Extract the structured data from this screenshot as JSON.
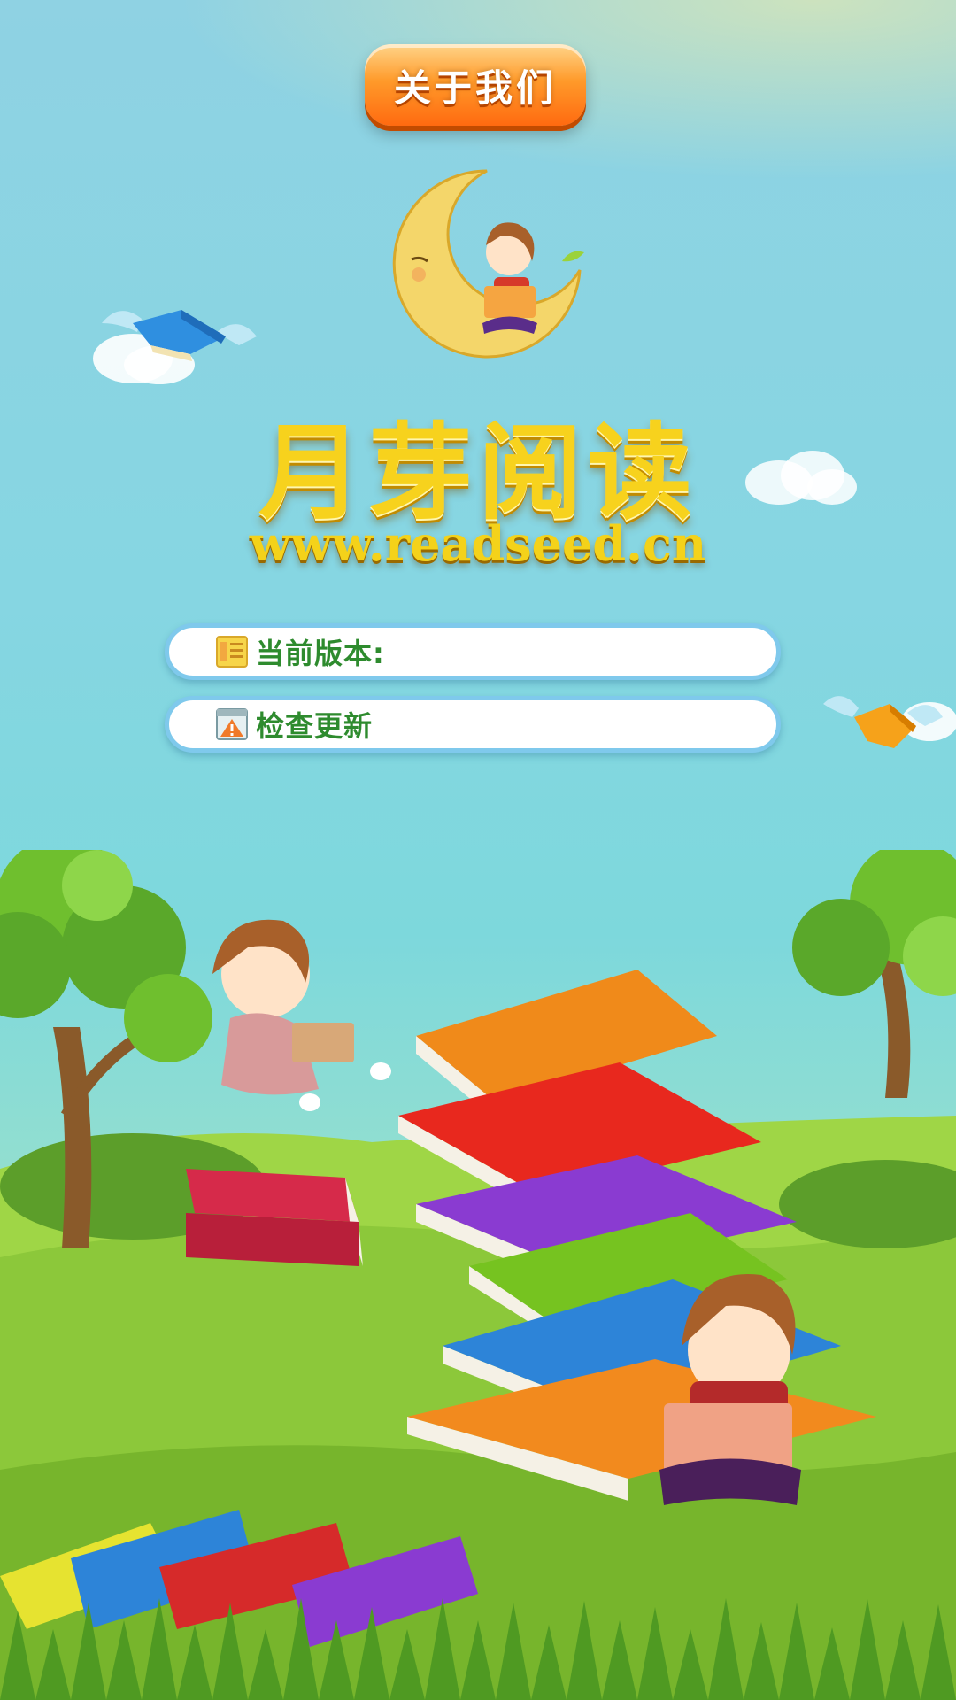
{
  "header": {
    "about_button_label": "关于我们"
  },
  "brand": {
    "name": "月芽阅读",
    "url": "www.readseed.cn"
  },
  "settings": {
    "items": [
      {
        "label": "当前版本:",
        "icon": "document-icon"
      },
      {
        "label": "检查更新",
        "icon": "warning-icon"
      }
    ]
  },
  "colors": {
    "button": "#ff7a18",
    "title": "#f7d21d",
    "item_text": "#2e8b2e",
    "item_border": "#7fc9ec"
  }
}
